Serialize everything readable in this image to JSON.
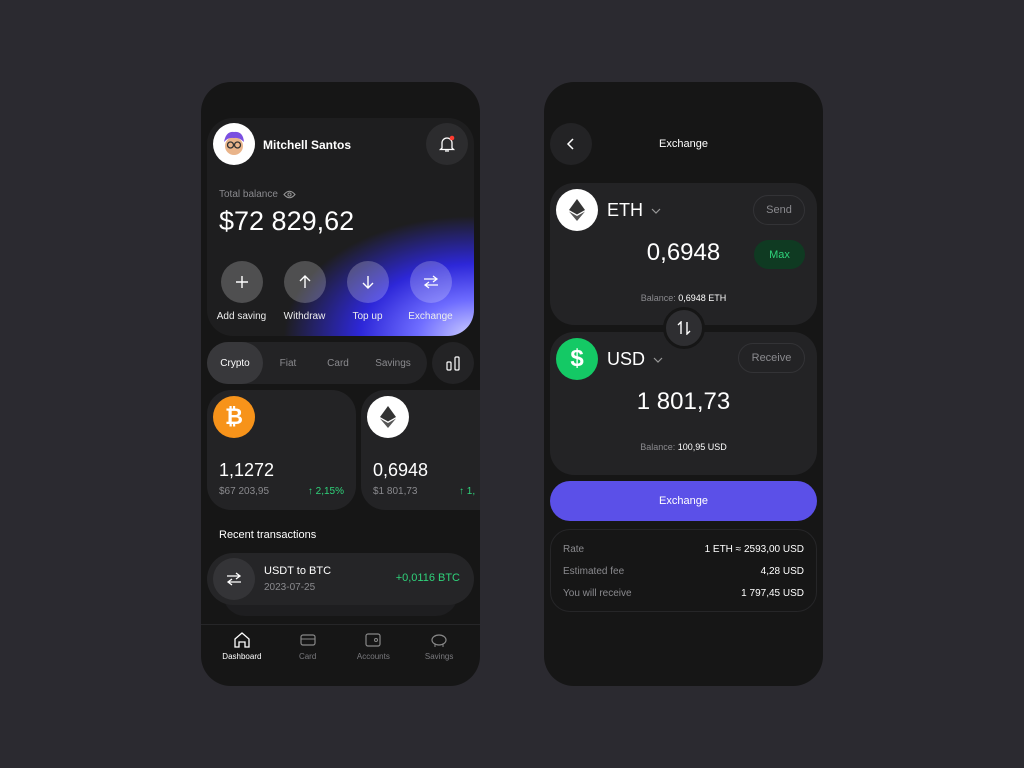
{
  "dashboard": {
    "user_name": "Mitchell Santos",
    "total_balance_label": "Total balance",
    "total_balance": "$72 829,62",
    "actions": [
      {
        "label": "Add saving",
        "icon": "plus-icon"
      },
      {
        "label": "Withdraw",
        "icon": "arrow-up-icon"
      },
      {
        "label": "Top up",
        "icon": "arrow-down-icon"
      },
      {
        "label": "Exchange",
        "icon": "swap-icon"
      }
    ],
    "tabs": [
      "Crypto",
      "Fiat",
      "Card",
      "Savings"
    ],
    "active_tab": "Crypto",
    "assets": [
      {
        "coin": "BTC",
        "amount": "1,1272",
        "value": "$67 203,95",
        "change": "2,15%",
        "color": "#f7931a"
      },
      {
        "coin": "ETH",
        "amount": "0,6948",
        "value": "$1 801,73",
        "change": "1,",
        "color": "#ffffff"
      }
    ],
    "recent_title": "Recent transactions",
    "transaction": {
      "title": "USDT to BTC",
      "date": "2023-07-25",
      "amount": "+0,0116 BTC"
    },
    "nav": [
      "Dashboard",
      "Card",
      "Accounts",
      "Savings"
    ]
  },
  "exchange": {
    "title": "Exchange",
    "from": {
      "currency": "ETH",
      "amount": "0,6948",
      "action": "Send",
      "max": "Max",
      "balance_label": "Balance:",
      "balance": "0,6948 ETH"
    },
    "to": {
      "currency": "USD",
      "amount": "1 801,73",
      "action": "Receive",
      "balance_label": "Balance:",
      "balance": "100,95 USD"
    },
    "button": "Exchange",
    "details": [
      {
        "label": "Rate",
        "value": "1 ETH ≈ 2593,00 USD"
      },
      {
        "label": "Estimated fee",
        "value": "4,28 USD"
      },
      {
        "label": "You will receive",
        "value": "1 797,45 USD"
      }
    ]
  },
  "colors": {
    "accent": "#5b50e8",
    "positive": "#2fd27a",
    "background": "#2b2a30"
  }
}
